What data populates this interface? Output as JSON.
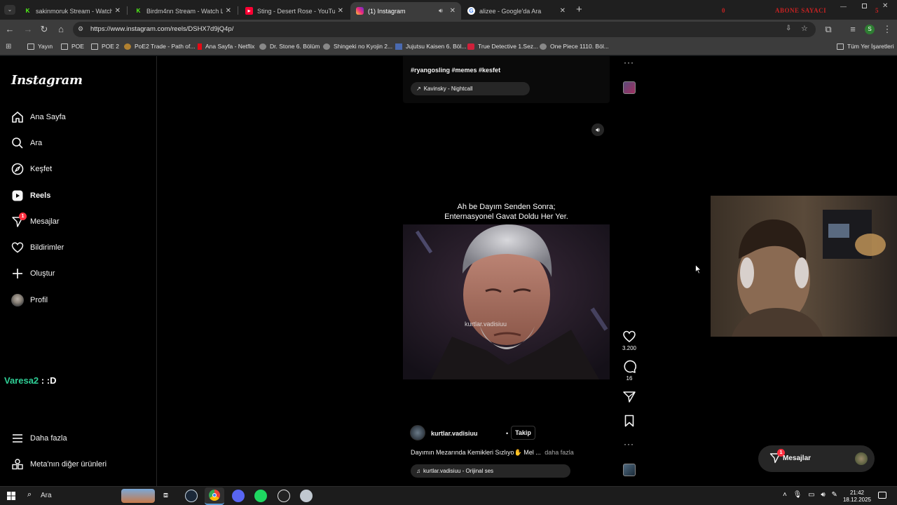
{
  "browser": {
    "tabs": [
      {
        "title": "sakinmoruk Stream - Watch Live",
        "favicon": "kick-icon",
        "active": false
      },
      {
        "title": "Birdm4nn Stream - Watch Live",
        "favicon": "kick-icon",
        "active": false
      },
      {
        "title": "Sting - Desert Rose - YouTube",
        "favicon": "youtube-icon",
        "active": false
      },
      {
        "title": "(1) Instagram",
        "favicon": "instagram-icon",
        "active": true
      },
      {
        "title": "alizee - Google'da Ara",
        "favicon": "google-icon",
        "active": false
      }
    ],
    "new_tab": "+",
    "url": "https://www.instagram.com/reels/DSHX7d9jQ4p/",
    "profile_initial": "S",
    "overlay_counter": {
      "left": "0",
      "label": "ABONE SAYACI",
      "right": "5"
    },
    "bookmarks": [
      {
        "label": "Yayın",
        "type": "folder"
      },
      {
        "label": "POE",
        "type": "folder"
      },
      {
        "label": "POE 2",
        "type": "folder"
      },
      {
        "label": "PoE2 Trade - Path of...",
        "type": "link"
      },
      {
        "label": "Ana Sayfa - Netflix",
        "type": "link"
      },
      {
        "label": "Dr. Stone 6. Bölüm",
        "type": "link"
      },
      {
        "label": "Shingeki no Kyojin 2...",
        "type": "link"
      },
      {
        "label": "Jujutsu Kaisen 6. Böl...",
        "type": "link"
      },
      {
        "label": "True Detective 1.Sez...",
        "type": "link"
      },
      {
        "label": "One Piece 1110. Böl...",
        "type": "link"
      }
    ],
    "all_bookmarks": "Tüm Yer İşaretleri"
  },
  "sidebar": {
    "logo": "Instagram",
    "items": [
      {
        "label": "Ana Sayfa",
        "icon": "home-icon"
      },
      {
        "label": "Ara",
        "icon": "search-icon"
      },
      {
        "label": "Keşfet",
        "icon": "compass-icon"
      },
      {
        "label": "Reels",
        "icon": "reels-icon"
      },
      {
        "label": "Mesajlar",
        "icon": "messenger-icon",
        "badge": "1"
      },
      {
        "label": "Bildirimler",
        "icon": "heart-icon"
      },
      {
        "label": "Oluştur",
        "icon": "plus-icon"
      },
      {
        "label": "Profil",
        "icon": "avatar-icon"
      }
    ],
    "more": "Daha fazla",
    "meta": "Meta'nın diğer ürünleri"
  },
  "overlay_chat": {
    "user": "Varesa2",
    "message": ": :D"
  },
  "previous_reel": {
    "hashtags": "#ryangosling #memes #kesfet",
    "audio": "Kavinsky - Nightcall"
  },
  "reel": {
    "subtitle_line1": "Ah be Dayım Senden Sonra;",
    "subtitle_line2": "Enternasyonel Gavat Doldu Her Yer.",
    "watermark": "kurtlar.vadisiuu",
    "username": "kurtlar.vadisiuu",
    "dot": "•",
    "follow": "Takip",
    "caption": "Dayımın Mezarında Kemikleri Sızlıyo✋ Mel ...",
    "more": "daha fazla",
    "audio": "kurtlar.vadisiuu - Orijinal ses",
    "likes": "3.200",
    "comments": "16"
  },
  "messages_pill": {
    "label": "Mesajlar",
    "badge": "1"
  },
  "taskbar": {
    "search": "Ara",
    "time": "21:42",
    "date": "18.12.2025"
  }
}
